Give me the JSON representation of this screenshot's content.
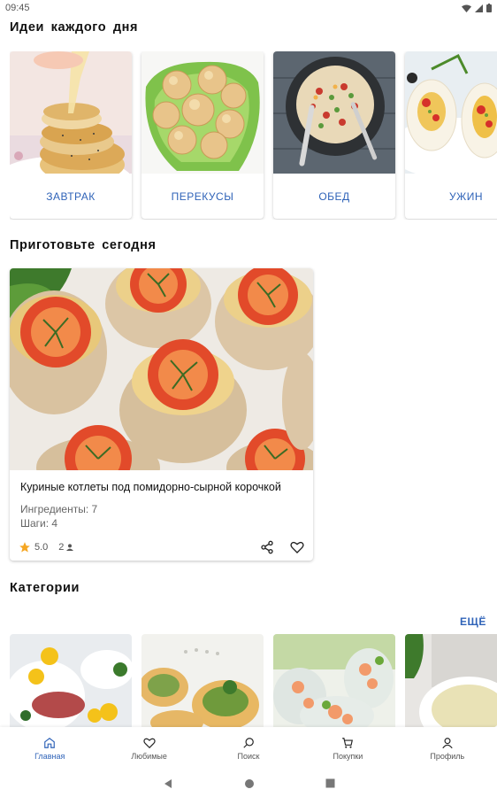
{
  "status_bar": {
    "time": "09:45"
  },
  "daily_ideas": {
    "title": "Идеи  каждого  дня",
    "items": [
      {
        "label": "ЗАВТРАК"
      },
      {
        "label": "ПЕРЕКУСЫ"
      },
      {
        "label": "ОБЕД"
      },
      {
        "label": "УЖИН"
      }
    ]
  },
  "today": {
    "title": "Приготовьте  сегодня",
    "recipe": {
      "title": "Куриные котлеты под помидорно-сырной корочкой",
      "ingredients": "Ингредиенты: 7",
      "steps": "Шаги: 4",
      "rating": "5.0",
      "people": "2"
    }
  },
  "categories": {
    "title": "Категории",
    "more_label": "ЕЩЁ"
  },
  "bottom_nav": {
    "items": [
      {
        "label": "Главная",
        "icon": "home-icon",
        "active": true
      },
      {
        "label": "Любимые",
        "icon": "heart-icon"
      },
      {
        "label": "Поиск",
        "icon": "search-icon"
      },
      {
        "label": "Покупки",
        "icon": "cart-icon"
      },
      {
        "label": "Профиль",
        "icon": "person-icon"
      }
    ]
  },
  "colors": {
    "accent": "#2f63b8",
    "star": "#f5a623"
  }
}
